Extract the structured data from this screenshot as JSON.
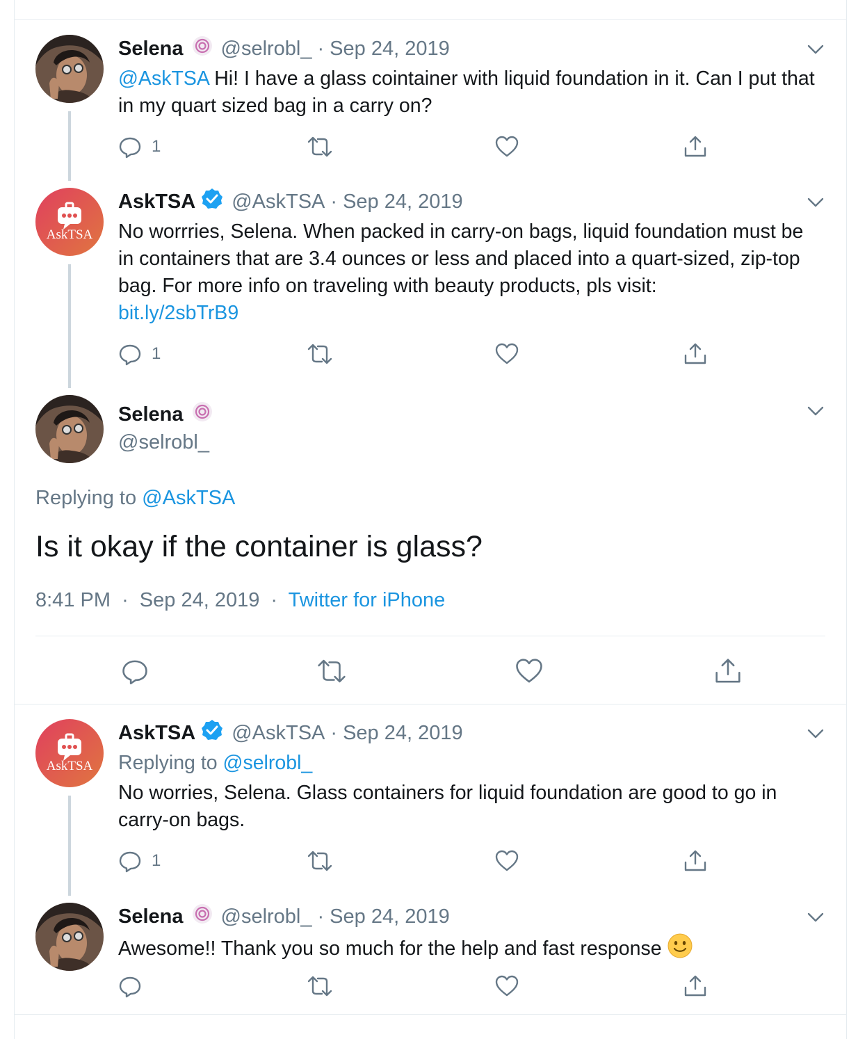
{
  "colors": {
    "link": "#1b95e0",
    "muted": "#657786",
    "verified": "#1da1f2",
    "asktsa_avatar": "#d94c5a"
  },
  "tweet1": {
    "name": "Selena",
    "handle": "@selrobl_",
    "dot": "·",
    "date": "Sep 24, 2019",
    "mention": "@AskTSA",
    "text": " Hi! I have a glass cointainer with liquid foundation in it. Can I put that in my quart sized bag in a carry on?",
    "reply_count": "1"
  },
  "tweet2": {
    "name": "AskTSA",
    "handle": "@AskTSA",
    "dot": "·",
    "date": "Sep 24, 2019",
    "text": "No worrries, Selena. When packed in carry-on bags, liquid foundation must be in containers that are 3.4 ounces or less and placed into a quart-sized, zip-top bag. For more info on traveling with beauty products, pls visit:",
    "link": "bit.ly/2sbTrB9",
    "reply_count": "1",
    "avatar_label": "AskTSA"
  },
  "main": {
    "name": "Selena",
    "handle": "@selrobl_",
    "replying_prefix": "Replying to ",
    "replying_handle": "@AskTSA",
    "text": "Is it okay if the container is glass?",
    "time": "8:41 PM",
    "dot": "·",
    "date": "Sep 24, 2019",
    "source": "Twitter for iPhone"
  },
  "tweet3": {
    "name": "AskTSA",
    "handle": "@AskTSA",
    "dot": "·",
    "date": "Sep 24, 2019",
    "replying_prefix": "Replying to ",
    "replying_handle": "@selrobl_",
    "text": "No worries, Selena. Glass containers for liquid foundation are good to go in carry-on bags.",
    "reply_count": "1",
    "avatar_label": "AskTSA"
  },
  "tweet4": {
    "name": "Selena",
    "handle": "@selrobl_",
    "dot": "·",
    "date": "Sep 24, 2019",
    "text": "Awesome!! Thank you so much for the help and fast response ",
    "emoji": "slightly-smiling-face"
  }
}
